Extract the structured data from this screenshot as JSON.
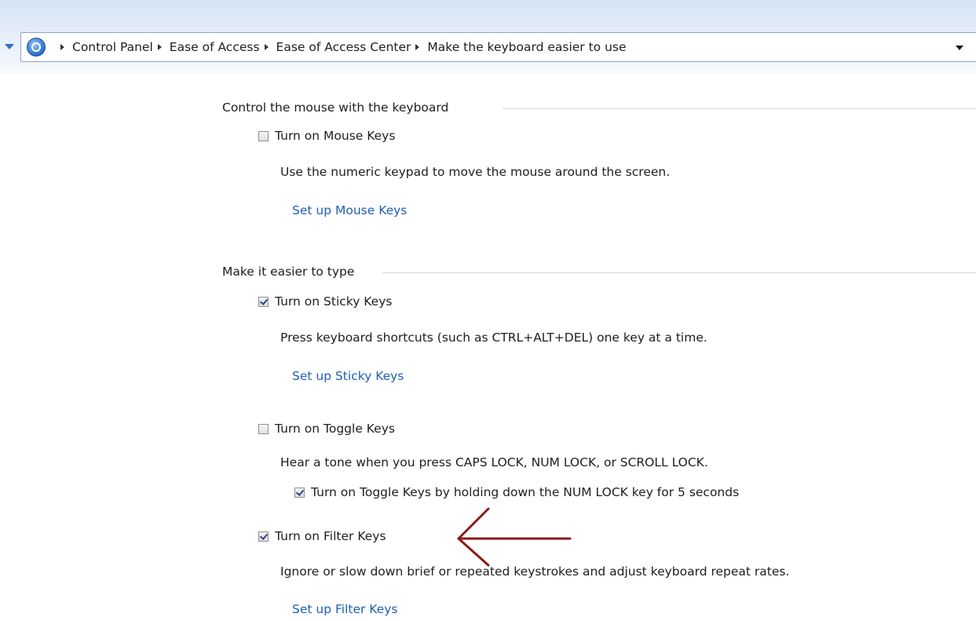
{
  "breadcrumb": {
    "items": [
      "Control Panel",
      "Ease of Access",
      "Ease of Access Center",
      "Make the keyboard easier to use"
    ]
  },
  "sections": {
    "mouse": {
      "heading": "Control the mouse with the keyboard",
      "mouse_keys": {
        "label": "Turn on Mouse Keys",
        "checked": false,
        "description": "Use the numeric keypad to move the mouse around the screen.",
        "setup_link": "Set up Mouse Keys"
      }
    },
    "typing": {
      "heading": "Make it easier to type",
      "sticky_keys": {
        "label": "Turn on Sticky Keys",
        "checked": true,
        "description": "Press keyboard shortcuts (such as CTRL+ALT+DEL) one key at a time.",
        "setup_link": "Set up Sticky Keys"
      },
      "toggle_keys": {
        "label": "Turn on Toggle Keys",
        "checked": false,
        "description": "Hear a tone when you press CAPS LOCK, NUM LOCK, or SCROLL LOCK.",
        "sub_option": {
          "label": "Turn on Toggle Keys by holding down the NUM LOCK key for 5 seconds",
          "checked": true
        }
      },
      "filter_keys": {
        "label": "Turn on Filter Keys",
        "checked": true,
        "description": "Ignore or slow down brief or repeated keystrokes and adjust keyboard repeat rates.",
        "setup_link": "Set up Filter Keys"
      }
    }
  },
  "colors": {
    "link": "#1f5fb4",
    "annotation_arrow": "#8b1a1a"
  }
}
